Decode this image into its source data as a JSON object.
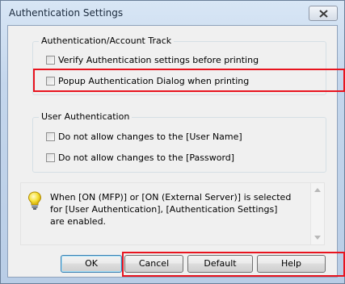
{
  "window": {
    "title": "Authentication Settings"
  },
  "group_auth": {
    "legend": "Authentication/Account Track",
    "verify_label": "Verify Authentication settings before printing",
    "popup_label": "Popup Authentication Dialog when printing"
  },
  "group_user": {
    "legend": "User Authentication",
    "username_label": "Do not allow changes to the [User Name]",
    "password_label": "Do not allow changes to the [Password]"
  },
  "info": {
    "text": "When [ON (MFP)] or [ON (External Server)] is selected for [User Authentication], [Authentication Settings] are enabled."
  },
  "buttons": {
    "ok": "OK",
    "cancel": "Cancel",
    "default": "Default",
    "help": "Help"
  },
  "highlight_color": "#e8141f",
  "icons": {
    "close": "close-icon",
    "info": "lightbulb-icon",
    "scroll_up": "scroll-up-arrow-icon",
    "scroll_down": "scroll-down-arrow-icon"
  }
}
